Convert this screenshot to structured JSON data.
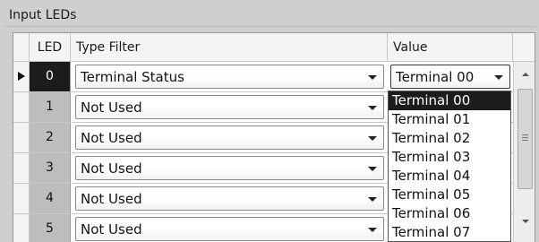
{
  "group": {
    "title": "Input LEDs"
  },
  "columns": {
    "led": "LED",
    "type_filter": "Type Filter",
    "value": "Value"
  },
  "rows": [
    {
      "led": "0",
      "type_filter": "Terminal Status",
      "value": "Terminal 00",
      "current": true
    },
    {
      "led": "1",
      "type_filter": "Not Used",
      "value": ""
    },
    {
      "led": "2",
      "type_filter": "Not Used",
      "value": ""
    },
    {
      "led": "3",
      "type_filter": "Not Used",
      "value": ""
    },
    {
      "led": "4",
      "type_filter": "Not Used",
      "value": ""
    },
    {
      "led": "5",
      "type_filter": "Not Used",
      "value": ""
    }
  ],
  "value_dropdown": {
    "highlighted": "Terminal 00",
    "options": [
      "Terminal 00",
      "Terminal 01",
      "Terminal 02",
      "Terminal 03",
      "Terminal 04",
      "Terminal 05",
      "Terminal 06",
      "Terminal 07"
    ]
  }
}
